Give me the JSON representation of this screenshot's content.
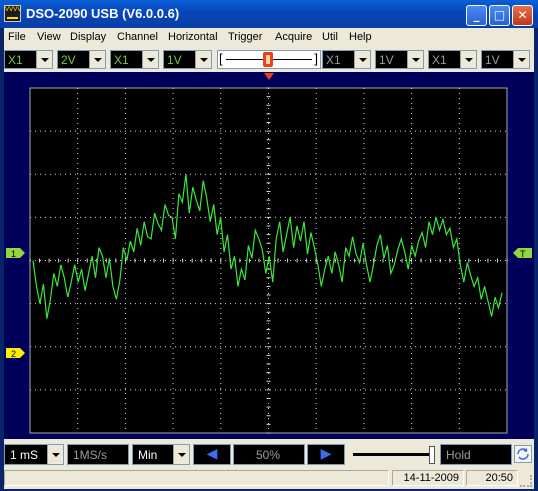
{
  "window": {
    "title": "DSO-2090 USB (V6.0.0.6)",
    "icon_text": "VVVV",
    "minimize": "_",
    "maximize": "□",
    "close": "✕"
  },
  "menu": [
    "File",
    "View",
    "Display",
    "Channel",
    "Horizontal",
    "Trigger",
    "Acquire",
    "Util",
    "Help"
  ],
  "controls": {
    "ch1_probe": "X1",
    "ch1_volts": "2V",
    "ch2_probe": "X1",
    "ch2_volts": "1V",
    "trig_left": "[",
    "trig_right": "]",
    "ch3_probe": "X1",
    "ch3_volts": "1V",
    "ch4_probe": "X1",
    "ch4_volts": "1V"
  },
  "markers": {
    "ch1": "1",
    "ch2": "2",
    "trig_level": "T"
  },
  "bottom": {
    "timebase": "1 mS",
    "sample_rate": "1MS/s",
    "mode": "Min",
    "prev": "◀",
    "position": "50%",
    "next": "▶",
    "hold": "Hold"
  },
  "status": {
    "date": "14-11-2009",
    "time": "20:50"
  },
  "colors": {
    "trace": "#39e839",
    "grid": "#d9d9d9",
    "screen_bg": "#000000",
    "marker_bg": "#ffee00"
  },
  "trace_data": {
    "grid_divisions": {
      "x": 10,
      "y": 8
    },
    "y_divisions_from_center": [
      0.0,
      -0.6,
      -1.0,
      -0.55,
      -1.35,
      -0.9,
      -0.3,
      -0.6,
      -0.1,
      -0.4,
      -0.85,
      -0.5,
      -0.1,
      -0.5,
      -0.2,
      -0.7,
      -0.3,
      0.1,
      -0.4,
      0.3,
      0.1,
      -0.4,
      0.05,
      -0.6,
      -0.9,
      -0.45,
      0.3,
      0.0,
      0.45,
      0.2,
      0.75,
      0.35,
      0.9,
      0.55,
      0.5,
      1.1,
      0.85,
      0.7,
      1.3,
      1.05,
      1.0,
      0.5,
      1.55,
      1.35,
      2.0,
      1.1,
      1.7,
      1.4,
      1.15,
      1.85,
      1.45,
      0.9,
      1.3,
      0.6,
      1.0,
      0.2,
      0.6,
      -0.2,
      0.1,
      -0.6,
      -0.2,
      -0.45,
      0.35,
      0.05,
      0.7,
      0.5,
      0.25,
      -0.3,
      0.1,
      -0.5,
      0.5,
      0.9,
      0.2,
      0.6,
      1.0,
      0.3,
      0.8,
      0.45,
      0.9,
      0.15,
      0.65,
      0.3,
      -0.1,
      -0.6,
      -0.2,
      0.1,
      -0.3,
      0.2,
      -0.1,
      -0.5,
      0.3,
      0.1,
      0.55,
      0.15,
      -0.05,
      0.4,
      -0.1,
      -0.5,
      -0.1,
      0.35,
      0.6,
      0.05,
      0.35,
      -0.3,
      -0.1,
      0.25,
      0.5,
      0.2,
      -0.2,
      0.35,
      0.1,
      0.45,
      0.65,
      0.3,
      0.9,
      0.6,
      1.0,
      0.7,
      0.95,
      0.6,
      0.75,
      0.3,
      0.5,
      -0.1,
      -0.5,
      -0.05,
      -0.35,
      -0.6,
      -0.4,
      -0.9,
      -0.6,
      -0.95,
      -1.3,
      -0.85,
      -1.1,
      -0.75
    ]
  }
}
